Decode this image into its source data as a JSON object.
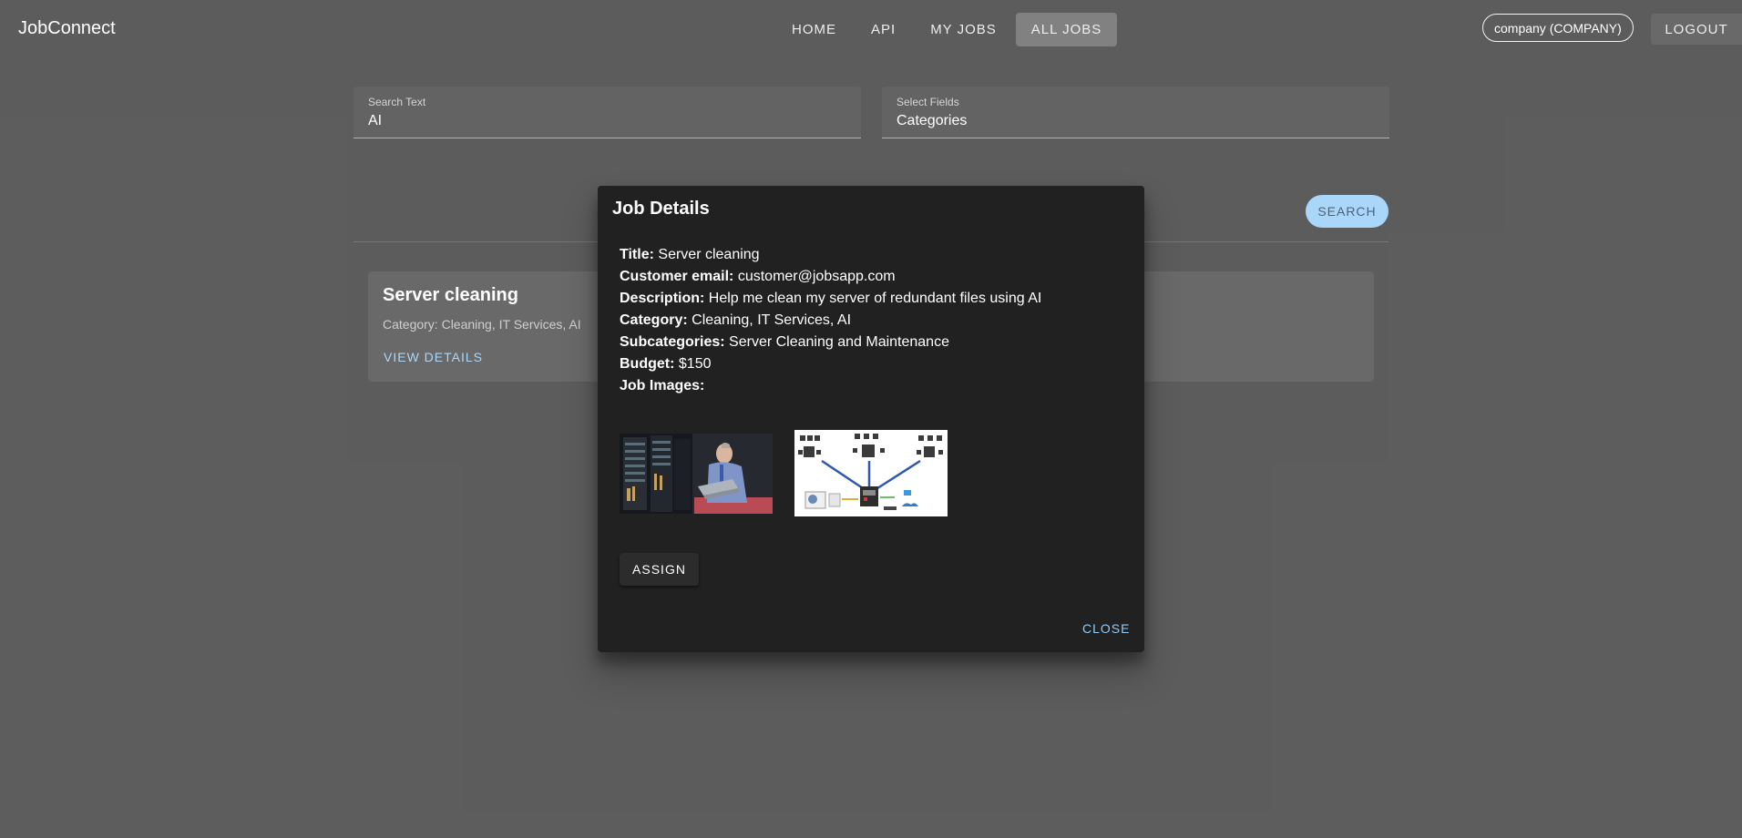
{
  "app": {
    "title": "JobConnect"
  },
  "nav": [
    {
      "label": "HOME",
      "active": false
    },
    {
      "label": "API",
      "active": false
    },
    {
      "label": "MY JOBS",
      "active": false
    },
    {
      "label": "ALL JOBS",
      "active": true
    }
  ],
  "account": {
    "chip": "company (COMPANY)",
    "logout": "LOGOUT"
  },
  "search": {
    "text_label": "Search Text",
    "text_value": "AI",
    "fields_label": "Select Fields",
    "fields_value": "Categories",
    "button": "SEARCH"
  },
  "results": [
    {
      "title": "Server cleaning",
      "category_line": "Category: Cleaning, IT Services, AI",
      "view_label": "VIEW DETAILS"
    }
  ],
  "dialog": {
    "title": "Job Details",
    "fields": [
      {
        "label": "Title:",
        "value": "Server cleaning"
      },
      {
        "label": "Customer email:",
        "value": "customer@jobsapp.com"
      },
      {
        "label": "Description:",
        "value": "Help me clean my server of redundant files using AI"
      },
      {
        "label": "Category:",
        "value": "Cleaning, IT Services, AI"
      },
      {
        "label": "Subcategories:",
        "value": "Server Cleaning and Maintenance"
      },
      {
        "label": "Budget:",
        "value": "$150"
      },
      {
        "label": "Job Images:",
        "value": ""
      }
    ],
    "assign": "ASSIGN",
    "close": "CLOSE"
  },
  "colors": {
    "accent": "#90caf9",
    "dialog_bg": "#212121",
    "page_bg": "#2a2a2a"
  }
}
